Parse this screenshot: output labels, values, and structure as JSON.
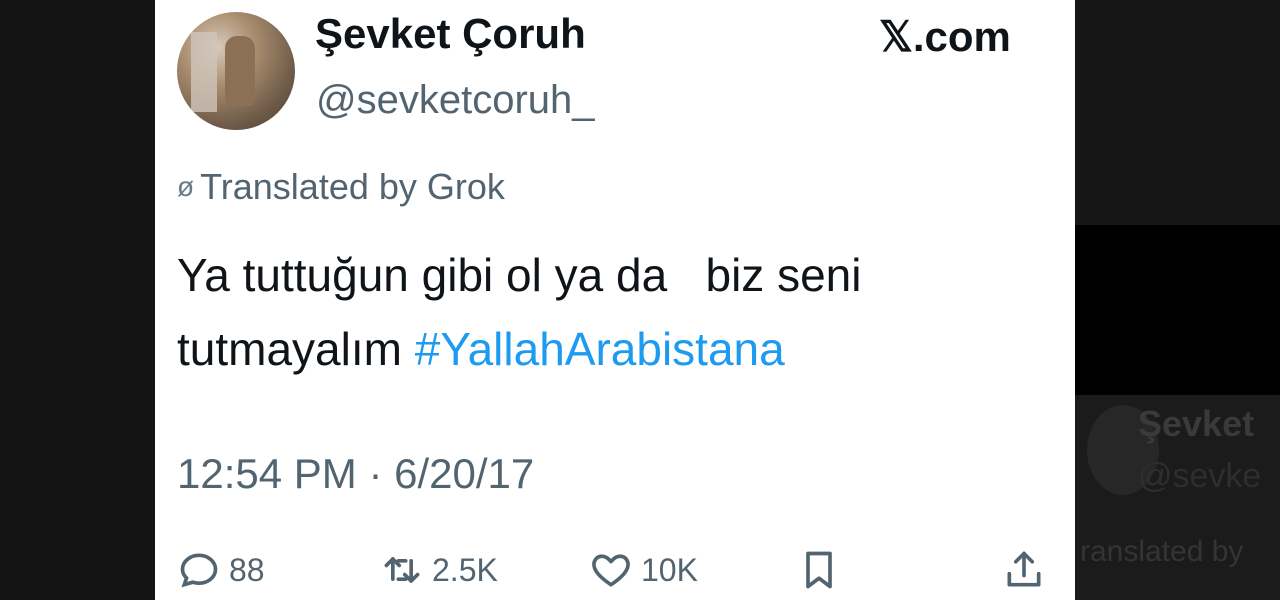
{
  "tweet": {
    "author_name": "Şevket Çoruh",
    "author_handle": "@sevketcoruh_",
    "brand": "𝕏.com",
    "translated_label": "Translated by Grok",
    "text_line1": "Ya tuttuğun gibi ol ya da   biz seni",
    "text_line2": "tutmayalım ",
    "hashtag": "#YallahArabistana",
    "timestamp": "12:54 PM · 6/20/17",
    "replies": "88",
    "reposts": "2.5K",
    "likes": "10K"
  },
  "background_tweet": {
    "author_name": "Şevket",
    "author_handle": "@sevke",
    "translated_label": "ranslated by"
  },
  "colors": {
    "hashtag": "#1d9bf0",
    "muted": "#536471",
    "text": "#0f1419"
  },
  "icons": [
    "translate-icon",
    "reply-icon",
    "repost-icon",
    "like-icon",
    "bookmark-icon",
    "share-icon"
  ]
}
